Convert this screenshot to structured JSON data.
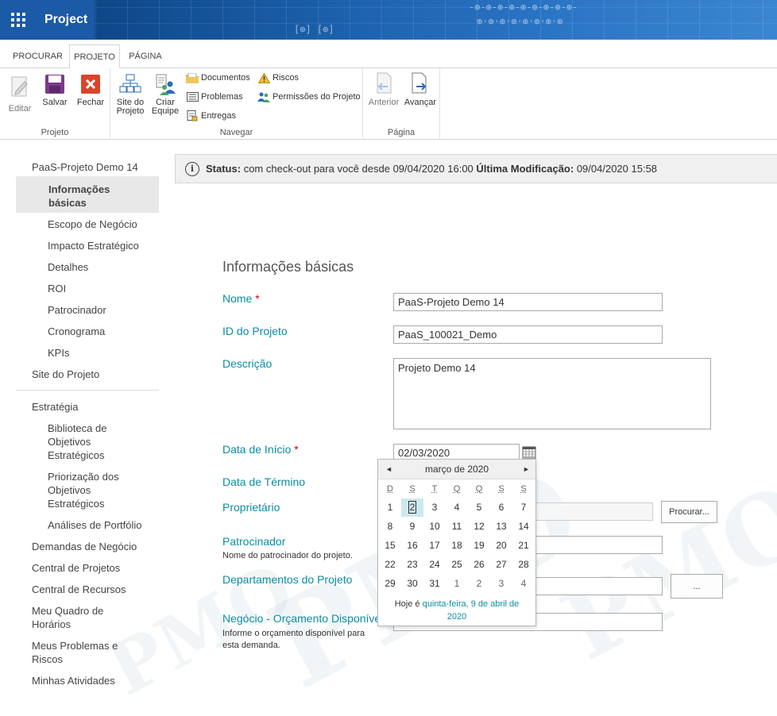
{
  "header": {
    "app_name": "Project"
  },
  "tabs": [
    {
      "label": "PROCURAR"
    },
    {
      "label": "PROJETO"
    },
    {
      "label": "PÁGINA"
    }
  ],
  "ribbon": {
    "groups": {
      "projeto": "Projeto",
      "navegar": "Navegar",
      "pagina": "Página"
    },
    "buttons": {
      "editar": "Editar",
      "salvar": "Salvar",
      "fechar": "Fechar",
      "site_l1": "Site do",
      "site_l2": "Projeto",
      "criar_l1": "Criar",
      "criar_l2": "Equipe",
      "documentos": "Documentos",
      "problemas": "Problemas",
      "entregas": "Entregas",
      "riscos": "Riscos",
      "permissoes": "Permissões do Projeto",
      "anterior": "Anterior",
      "avancar": "Avançar"
    }
  },
  "nav": {
    "items": [
      {
        "label": "PaaS-Projeto Demo 14"
      },
      {
        "label": "Informações básicas"
      },
      {
        "label": "Escopo de Negócio"
      },
      {
        "label": "Impacto Estratégico"
      },
      {
        "label": "Detalhes"
      },
      {
        "label": "ROI"
      },
      {
        "label": "Patrocinador"
      },
      {
        "label": "Cronograma"
      },
      {
        "label": "KPIs"
      },
      {
        "label": "Site do Projeto"
      },
      {
        "label": "Estratégia"
      },
      {
        "label": "Biblioteca de Objetivos Estratégicos"
      },
      {
        "label": "Priorização dos Objetivos Estratégicos"
      },
      {
        "label": "Análises de Portfólio"
      },
      {
        "label": "Demandas de Negócio"
      },
      {
        "label": "Central de Projetos"
      },
      {
        "label": "Central de Recursos"
      },
      {
        "label": "Meu Quadro de Horários"
      },
      {
        "label": "Meus Problemas e Riscos"
      },
      {
        "label": "Minhas Atividades"
      }
    ]
  },
  "status": {
    "label": "Status:",
    "text": "com check-out para você desde 09/04/2020 16:00",
    "mod_label": "Última Modificação:",
    "mod_value": "09/04/2020 15:58"
  },
  "form": {
    "section_title": "Informações básicas",
    "nome": {
      "label": "Nome",
      "req": "*",
      "value": "PaaS-Projeto Demo 14"
    },
    "id": {
      "label": "ID do Projeto",
      "value": "PaaS_100021_Demo"
    },
    "descricao": {
      "label": "Descrição",
      "value": "Projeto Demo 14"
    },
    "inicio": {
      "label": "Data de Início",
      "req": "*",
      "value": "02/03/2020"
    },
    "termino": {
      "label": "Data de Término"
    },
    "proprietario": {
      "label": "Proprietário",
      "button": "Procurar..."
    },
    "patrocinador": {
      "label": "Patrocinador",
      "desc": "Nome do patrocinador do projeto."
    },
    "departamentos": {
      "label": "Departamentos do Projeto",
      "button": "..."
    },
    "orcamento": {
      "label": "Negócio - Orçamento Disponível",
      "desc": "Informe o orçamento disponível para esta demanda."
    }
  },
  "datepicker": {
    "month": "março de 2020",
    "prev": "◄",
    "next": "►",
    "dows": [
      "D",
      "S",
      "T",
      "Q",
      "Q",
      "S",
      "S"
    ],
    "weeks": [
      [
        "1",
        "2",
        "3",
        "4",
        "5",
        "6",
        "7"
      ],
      [
        "8",
        "9",
        "10",
        "11",
        "12",
        "13",
        "14"
      ],
      [
        "15",
        "16",
        "17",
        "18",
        "19",
        "20",
        "21"
      ],
      [
        "22",
        "23",
        "24",
        "25",
        "26",
        "27",
        "28"
      ],
      [
        "29",
        "30",
        "31",
        "1",
        "2",
        "3",
        "4"
      ]
    ],
    "today_prefix": "Hoje é",
    "today_link_1": "quinta-feira, 9 de abril de",
    "today_link_2": "2020"
  },
  "watermark": {
    "text": "PMO"
  },
  "colors": {
    "accent": "#0b8ea0",
    "topbar": "#1b5aa6",
    "required": "#cc0000",
    "selected_day": "#cde8f0"
  }
}
